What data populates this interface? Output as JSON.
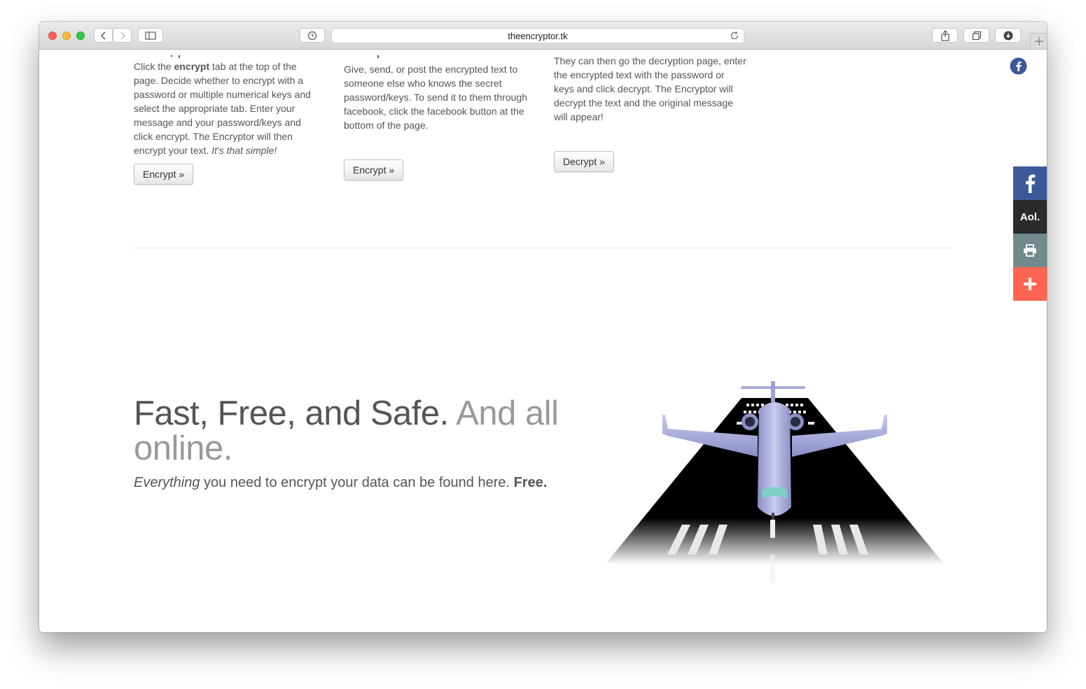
{
  "browser": {
    "url": "theencryptor.tk"
  },
  "columns": [
    {
      "text_before": "Click the ",
      "text_bold": "encrypt",
      "text_after": " tab at the top of the page. Decide whether to encrypt with a password or multiple numerical keys and select the appropriate tab. Enter your message and your password/keys and click encrypt. The Encryptor will then encrypt your text. ",
      "text_italic": "It's that simple!",
      "button": "Encrypt »"
    },
    {
      "text": "Give, send, or post the encrypted text to someone else who knows the secret password/keys. To send it to them through facebook, click the facebook button at the bottom of the page.",
      "button": "Encrypt »"
    },
    {
      "text": "They can then go the decryption page, enter the encrypted text with the password or keys and click decrypt. The Encryptor will decrypt the text and the original message will appear!",
      "button": "Decrypt »"
    }
  ],
  "share_bar": {
    "aol_label": "Aol."
  },
  "hero": {
    "title_main": "Fast, Free, and Safe.",
    "title_muted": "And all online.",
    "sub_italic": "Everything",
    "sub_text": " you need to encrypt your data can be found here. ",
    "sub_bold": "Free."
  },
  "colors": {
    "facebook": "#3b5998",
    "aol": "#2b2b2b",
    "print": "#738a8d",
    "more": "#ff6550"
  }
}
